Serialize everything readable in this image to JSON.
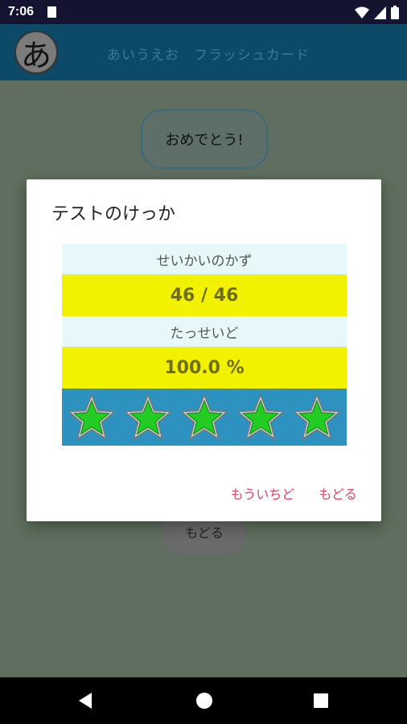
{
  "status": {
    "time": "7:06",
    "icons": [
      "sd-card-icon",
      "wifi-icon",
      "signal-icon",
      "battery-icon"
    ]
  },
  "app_bar": {
    "icon_char": "あ",
    "title": "あいうえお　フラッシュカード",
    "color": "#0d4a68"
  },
  "background": {
    "congrats": "おめでとう!",
    "back_button": "もどる"
  },
  "dialog": {
    "title": "テストのけっか",
    "correct_label": "せいかいのかず",
    "correct_value": "46 / 46",
    "rate_label": "たっせいど",
    "rate_value": "100.0 %",
    "stars_filled": 5,
    "stars_total": 5,
    "retry_button": "もういちど",
    "back_button": "もどる",
    "accent_color": "#d4456e",
    "star_color": "#22cc22",
    "label_bg": "#e6f8fa",
    "value_bg": "#f2f200",
    "stars_bg": "#2e92c0"
  },
  "nav": {
    "icons": [
      "back-icon",
      "home-icon",
      "recents-icon"
    ]
  }
}
